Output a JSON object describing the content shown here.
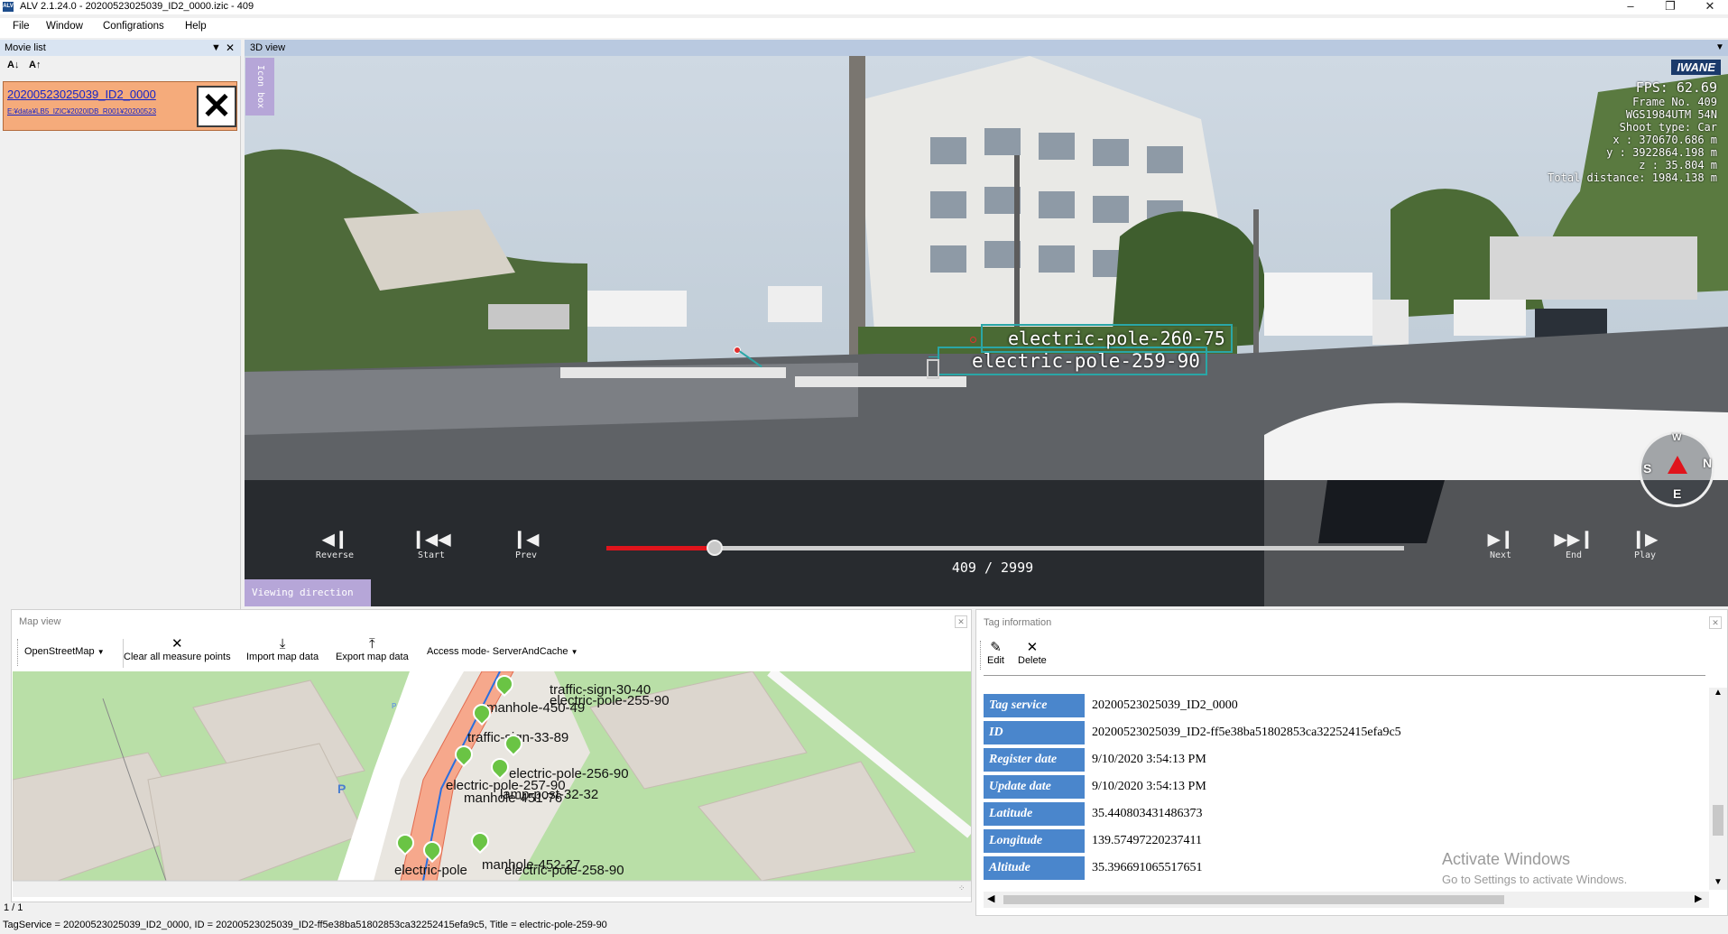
{
  "window": {
    "title": "ALV 2.1.24.0 - 20200523025039_ID2_0000.izic - 409",
    "app_icon_text": "ALV"
  },
  "menu": [
    "File",
    "Window",
    "Configrations",
    "Help"
  ],
  "movie_list": {
    "header": "Movie list",
    "item_name": "20200523025039_ID2_0000",
    "item_path": "E:¥data¥LB5_IZIC¥2020IDB_R001¥20200523"
  },
  "view3d": {
    "header": "3D view",
    "icon_box": "Icon box",
    "viewing_direction": "Viewing direction",
    "logo": "IWANE",
    "hud_lines": [
      "FPS: 62.69",
      "Frame No. 409",
      "WGS1984UTM 54N",
      "Shoot type: Car",
      "x : 370670.686 m",
      "y : 3922864.198 m",
      "z : 35.804 m",
      "Total distance: 1984.138 m"
    ],
    "tags": [
      "electric-pole-260-75",
      "electric-pole-259-90"
    ],
    "controls": {
      "reverse": "Reverse",
      "start": "Start",
      "prev": "Prev",
      "next": "Next",
      "end": "End",
      "play": "Play"
    },
    "frame_counter": "409 / 2999",
    "progress": 0.136,
    "compass": {
      "top": "W",
      "left": "S",
      "right": "N",
      "bottom": "E"
    }
  },
  "map_view": {
    "header": "Map view",
    "tile_source": "OpenStreetMap",
    "buttons": {
      "clear": "Clear all measure points",
      "import": "Import map data",
      "export": "Export map data"
    },
    "access_mode": "Access mode- ServerAndCache",
    "labels": [
      "manhole-450-49",
      "traffic-sign-30-40",
      "electric-pole-255-90",
      "traffic-sign-33-89",
      "electric-pole-256-90",
      "electric-pole-257-90",
      "lamp-post-32-32",
      "manhole-451-76",
      "electric-pole",
      "manhole-452-27",
      "electric-pole-258-90"
    ],
    "parking": "P"
  },
  "tag_info": {
    "header": "Tag information",
    "edit": "Edit",
    "delete": "Delete",
    "rows": [
      {
        "key": "Tag service",
        "value": "20200523025039_ID2_0000"
      },
      {
        "key": "ID",
        "value": "20200523025039_ID2-ff5e38ba51802853ca32252415efa9c5"
      },
      {
        "key": "Register date",
        "value": "9/10/2020 3:54:13 PM"
      },
      {
        "key": "Update date",
        "value": "9/10/2020 3:54:13 PM"
      },
      {
        "key": "Latitude",
        "value": "35.440803431486373"
      },
      {
        "key": "Longitude",
        "value": "139.57497220237411"
      },
      {
        "key": "Altitude",
        "value": "35.396691065517651"
      }
    ]
  },
  "watermark": {
    "line1": "Activate Windows",
    "line2": "Go to Settings to activate Windows."
  },
  "pager": "1 / 1",
  "status": "TagService = 20200523025039_ID2_0000, ID = 20200523025039_ID2-ff5e38ba51802853ca32252415efa9c5, Title = electric-pole-259-90"
}
